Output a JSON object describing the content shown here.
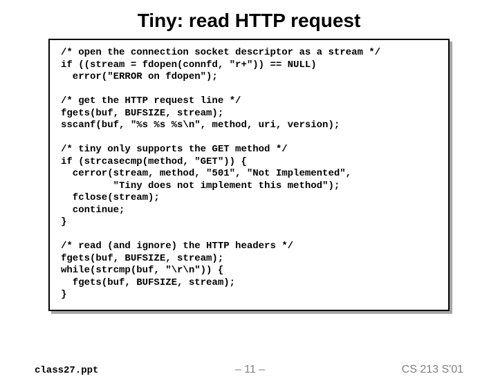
{
  "title": "Tiny: read HTTP request",
  "code": "/* open the connection socket descriptor as a stream */\nif ((stream = fdopen(connfd, \"r+\")) == NULL)\n  error(\"ERROR on fdopen\");\n\n/* get the HTTP request line */\nfgets(buf, BUFSIZE, stream);\nsscanf(buf, \"%s %s %s\\n\", method, uri, version);\n\n/* tiny only supports the GET method */\nif (strcasecmp(method, \"GET\")) {\n  cerror(stream, method, \"501\", \"Not Implemented\",\n         \"Tiny does not implement this method\");\n  fclose(stream);\n  continue;\n}\n\n/* read (and ignore) the HTTP headers */\nfgets(buf, BUFSIZE, stream);\nwhile(strcmp(buf, \"\\r\\n\")) {\n  fgets(buf, BUFSIZE, stream);\n}",
  "footer": {
    "left": "class27.ppt",
    "center": "– 11 –",
    "right": "CS 213 S'01"
  }
}
